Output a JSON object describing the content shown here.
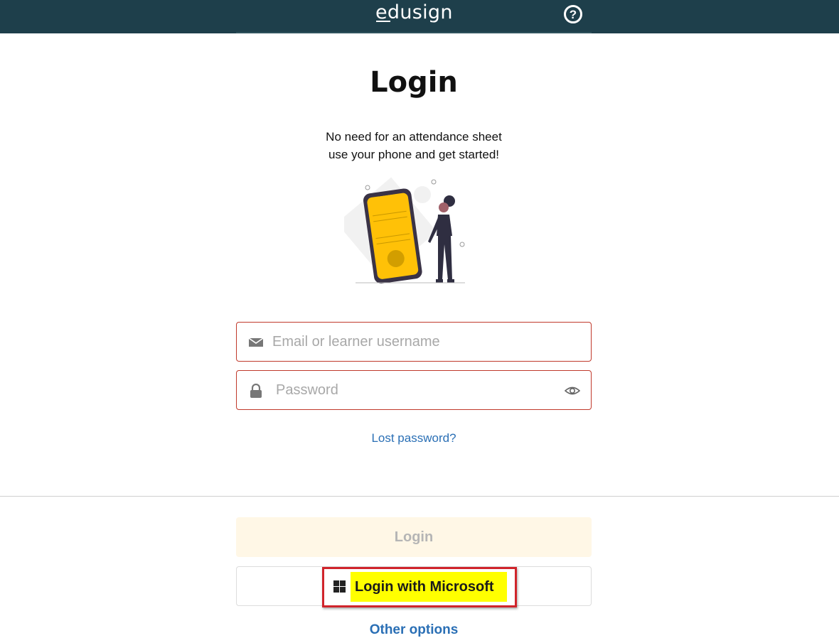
{
  "header": {
    "logo": "edusign",
    "help_icon": "question-circle-icon",
    "help_glyph": "?"
  },
  "main": {
    "title": "Login",
    "subtitle_line1": "No need for an attendance sheet",
    "subtitle_line2": "use your phone and get started!"
  },
  "form": {
    "email_placeholder": "Email or learner username",
    "email_icon": "envelope-icon",
    "password_placeholder": "Password",
    "password_icon": "lock-icon",
    "show_password_icon": "eye-icon",
    "lost_password": "Lost password?"
  },
  "actions": {
    "login_label": "Login",
    "microsoft_label": "Login with Microsoft",
    "microsoft_icon": "windows-icon",
    "other_options": "Other options"
  },
  "colors": {
    "header_bg": "#1e3f4b",
    "field_border": "#c0392b",
    "link": "#2a6fb5",
    "login_bg": "#fff7e6",
    "highlight": "#ffff00",
    "highlight_border": "#d0242b",
    "phone_yellow": "#ffc107"
  }
}
